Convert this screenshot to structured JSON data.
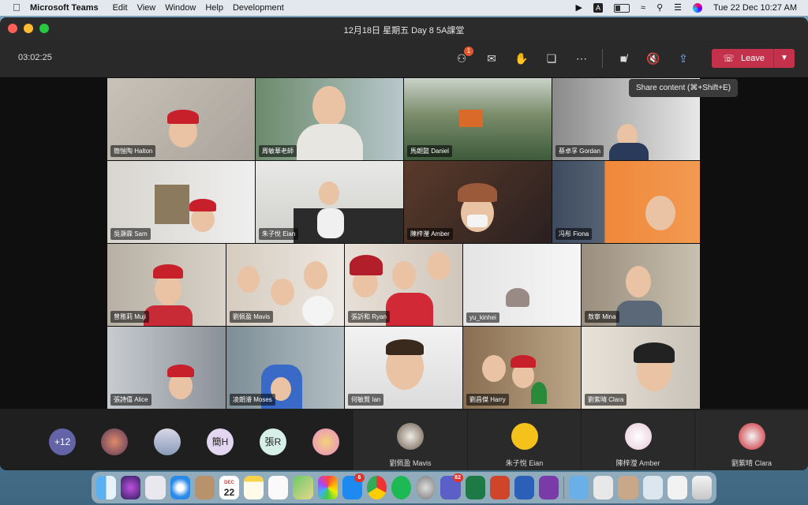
{
  "menubar": {
    "app_name": "Microsoft Teams",
    "menus": [
      "Edit",
      "View",
      "Window",
      "Help",
      "Development"
    ],
    "status_a": "A",
    "datetime": "Tue 22 Dec  10:27 AM"
  },
  "window": {
    "title": "12月18日 星期五 Day 8 5A課堂",
    "timer": "03:02:25"
  },
  "controls": {
    "participants_badge": "1",
    "leave_label": "Leave",
    "tooltip": "Share content (⌘+Shift+E)"
  },
  "tiles": [
    {
      "name": "簡愷陶 Halton"
    },
    {
      "name": "周敏華老師"
    },
    {
      "name": "馬朗懿 Daniel"
    },
    {
      "name": "蔡卓孚 Gordan"
    },
    {
      "name": "吳灝霖 Sam"
    },
    {
      "name": "朱子悅 Eian"
    },
    {
      "name": "陳梓瀅 Amber"
    },
    {
      "name": "冯彤 Fiona"
    },
    {
      "name": "曾雅莉 Muji"
    },
    {
      "name": "劉佩盈 Mavis"
    },
    {
      "name": "張訢和 Ryan"
    },
    {
      "name": "yu_kinhei"
    },
    {
      "name": "敖寧 Mina"
    },
    {
      "name": "張詩僖 Alice"
    },
    {
      "name": "凌朗濬 Moses"
    },
    {
      "name": "何敏賢 Ian"
    },
    {
      "name": "劉昌傑 Harry"
    },
    {
      "name": "劉紫晴 Clara"
    }
  ],
  "strip": {
    "overflow": "+12",
    "avatars": [
      {
        "initials": ""
      },
      {
        "initials": ""
      },
      {
        "initials": "簡H"
      },
      {
        "initials": "張R"
      },
      {
        "initials": ""
      }
    ],
    "pinned": [
      {
        "name": "劉佩盈 Mavis"
      },
      {
        "name": "朱子悅 Eian"
      },
      {
        "name": "陳梓瀅 Amber"
      },
      {
        "name": "劉紫晴 Clara"
      }
    ]
  },
  "dock": {
    "calendar_month": "DEC",
    "calendar_day": "22",
    "appstore_badge": "6",
    "teams_badge": "82"
  }
}
